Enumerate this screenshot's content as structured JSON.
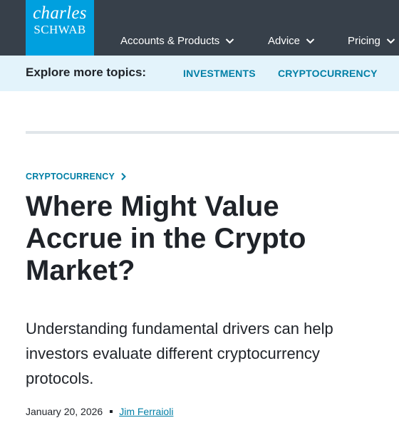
{
  "header": {
    "logo": {
      "line1": "charles",
      "line2": "SCHWAB"
    },
    "nav": [
      {
        "label": "Accounts & Products",
        "icon": "chevron-down-icon"
      },
      {
        "label": "Advice",
        "icon": "chevron-down-icon"
      },
      {
        "label": "Pricing",
        "icon": "chevron-down-icon"
      }
    ]
  },
  "topics": {
    "label": "Explore more topics:",
    "links": [
      "INVESTMENTS",
      "CRYPTOCURRENCY"
    ]
  },
  "article": {
    "category": "CRYPTOCURRENCY",
    "category_icon": "chevron-right-icon",
    "title": "Where Might Value Accrue in the Crypto Market?",
    "subtitle": "Understanding fundamental drivers can help investors evaluate different cryptocurrency protocols.",
    "date": "January 20, 2026",
    "author": "Jim Ferraioli"
  },
  "colors": {
    "nav_bg": "#37404a",
    "logo_bg": "#00a0df",
    "topics_bg": "#e3f3fb",
    "link": "#007fa6",
    "text": "#1f2329"
  }
}
